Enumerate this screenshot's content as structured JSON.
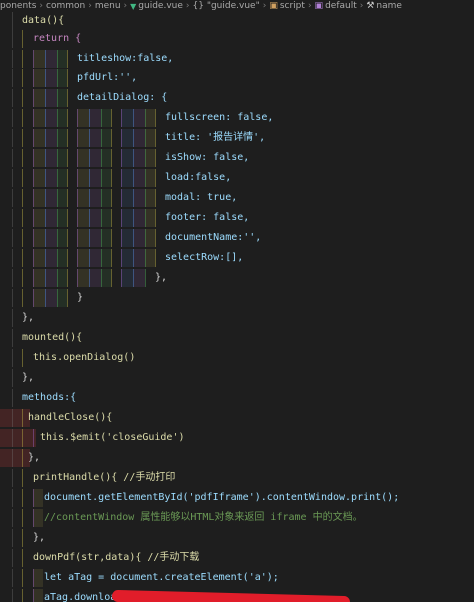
{
  "breadcrumb": {
    "items": [
      "ponents",
      "common",
      "menu",
      "guide.vue",
      "{} \"guide.vue\"",
      "script",
      "default",
      "name"
    ],
    "separator": ">"
  },
  "code": {
    "lines": [
      [
        "data(){"
      ],
      [
        "return {"
      ],
      [
        "titleshow:false,"
      ],
      [
        "pfdUrl:'',"
      ],
      [
        "detailDialog: {"
      ],
      [
        "fullscreen: false,"
      ],
      [
        "title: '报告详情',"
      ],
      [
        "isShow: false,"
      ],
      [
        "load:false,"
      ],
      [
        "modal: true,"
      ],
      [
        "footer: false,"
      ],
      [
        "documentName:'',"
      ],
      [
        "selectRow:[],"
      ],
      [
        "},"
      ],
      [
        "}"
      ],
      [
        "},"
      ],
      [
        "mounted(){"
      ],
      [
        "this.openDialog()"
      ],
      [
        "},"
      ],
      [
        "methods:{"
      ],
      [
        "handleClose(){"
      ],
      [
        "this.$emit('closeGuide')"
      ],
      [
        "},"
      ],
      [
        "printHandle(){  //手动打印"
      ],
      [
        "document.getElementById('pdfIframe').contentWindow.print();"
      ],
      [
        "//contentWindow 属性能够以HTML对象来返回 iframe 中的文档。"
      ],
      [
        "},"
      ],
      [
        "downPdf(str,data){  //手动下载"
      ],
      [
        "let aTag = document.createElement('a');"
      ],
      [
        "aTag.download"
      ]
    ]
  },
  "colors": {
    "background": "#1e1e1e",
    "keyword": "#c586c0",
    "property": "#9cdcfe",
    "function": "#dcdcaa",
    "string": "#ce9178",
    "boolean": "#569cd6",
    "comment": "#6a9955"
  }
}
